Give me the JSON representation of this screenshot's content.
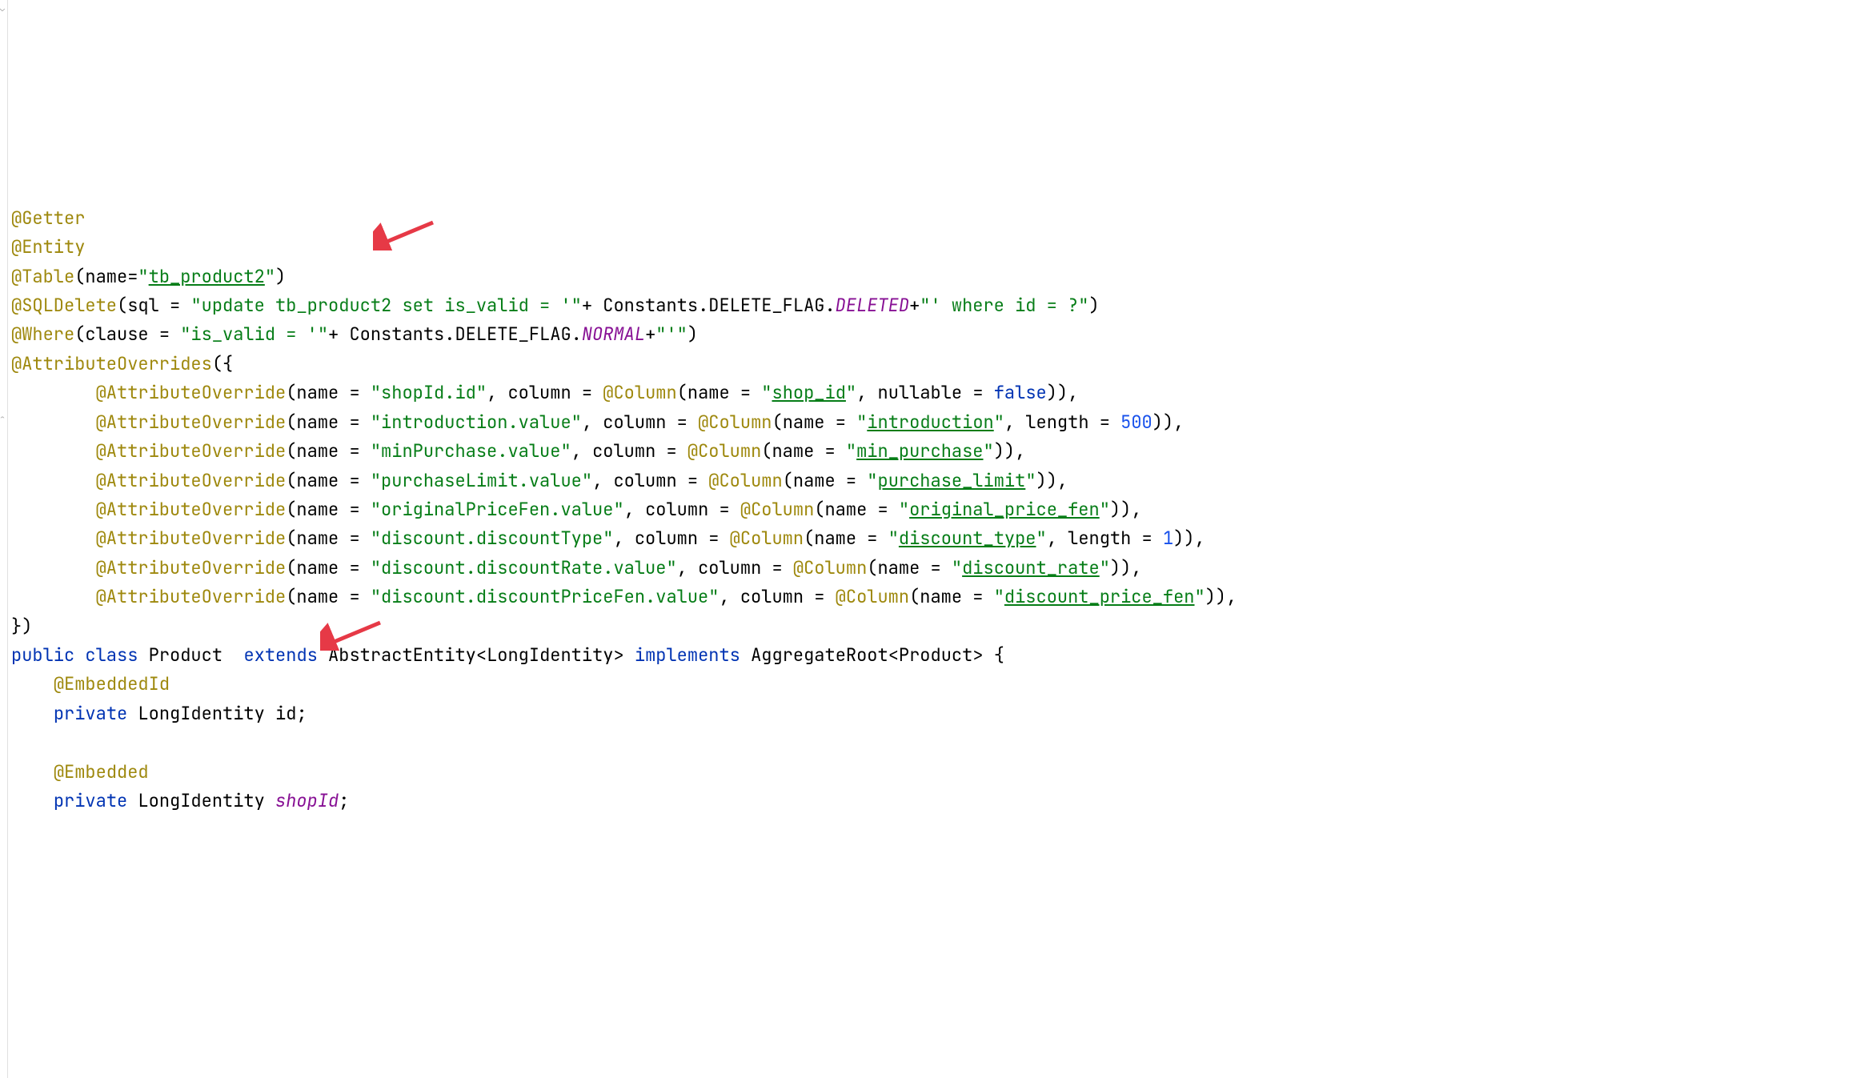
{
  "annotations": {
    "getter": "@Getter",
    "entity": "@Entity",
    "table": "@Table",
    "sqlDelete": "@SQLDelete",
    "where": "@Where",
    "attributeOverrides": "@AttributeOverrides",
    "attributeOverride": "@AttributeOverride",
    "column": "@Column",
    "embeddedId": "@EmbeddedId",
    "embedded": "@Embedded"
  },
  "keywords": {
    "public": "public",
    "class": "class",
    "extends": "extends",
    "implements": "implements",
    "private": "private",
    "false": "false"
  },
  "identifiers": {
    "name": "name",
    "sql": "sql",
    "clause": "clause",
    "column": "column",
    "nullable": "nullable",
    "length": "length",
    "Constants": "Constants",
    "DELETE_FLAG": "DELETE_FLAG",
    "Product": "Product",
    "AbstractEntity": "AbstractEntity",
    "LongIdentity": "LongIdentity",
    "AggregateRoot": "AggregateRoot",
    "id_field": "id"
  },
  "fields": {
    "DELETED": "DELETED",
    "NORMAL": "NORMAL",
    "shopId": "shopId"
  },
  "strings": {
    "tb_product2": "tb_product2",
    "update_sql_1": "\"update tb_product2 set is_valid = '\"",
    "update_sql_2": "\"' where id = ?\"",
    "is_valid_1": "\"is_valid = '\"",
    "is_valid_2": "\"'\"",
    "shopId_id": "\"shopId.id\"",
    "shop_id": "shop_id",
    "introduction_value": "\"introduction.value\"",
    "introduction": "introduction",
    "minPurchase_value": "\"minPurchase.value\"",
    "min_purchase": "min_purchase",
    "purchaseLimit_value": "\"purchaseLimit.value\"",
    "purchase_limit": "purchase_limit",
    "originalPriceFen_value": "\"originalPriceFen.value\"",
    "original_price_fen": "original_price_fen",
    "discount_discountType": "\"discount.discountType\"",
    "discount_type": "discount_type",
    "discount_discountRate_value": "\"discount.discountRate.value\"",
    "discount_rate": "discount_rate",
    "discount_discountPriceFen_value": "\"discount.discountPriceFen.value\"",
    "discount_price_fen": "discount_price_fen"
  },
  "numbers": {
    "n500": "500",
    "n1": "1"
  },
  "punct": {
    "eq": "=",
    "comma": ",",
    "plus": "+",
    "dot": ".",
    "openParen": "(",
    "closeParen": ")",
    "openBrace": "{",
    "closeBrace": "}",
    "closeParenComma": "),",
    "closeParenCloseParenComma": ")),",
    "lt": "<",
    "gt": ">",
    "semi": ";",
    "dquote": "\""
  }
}
